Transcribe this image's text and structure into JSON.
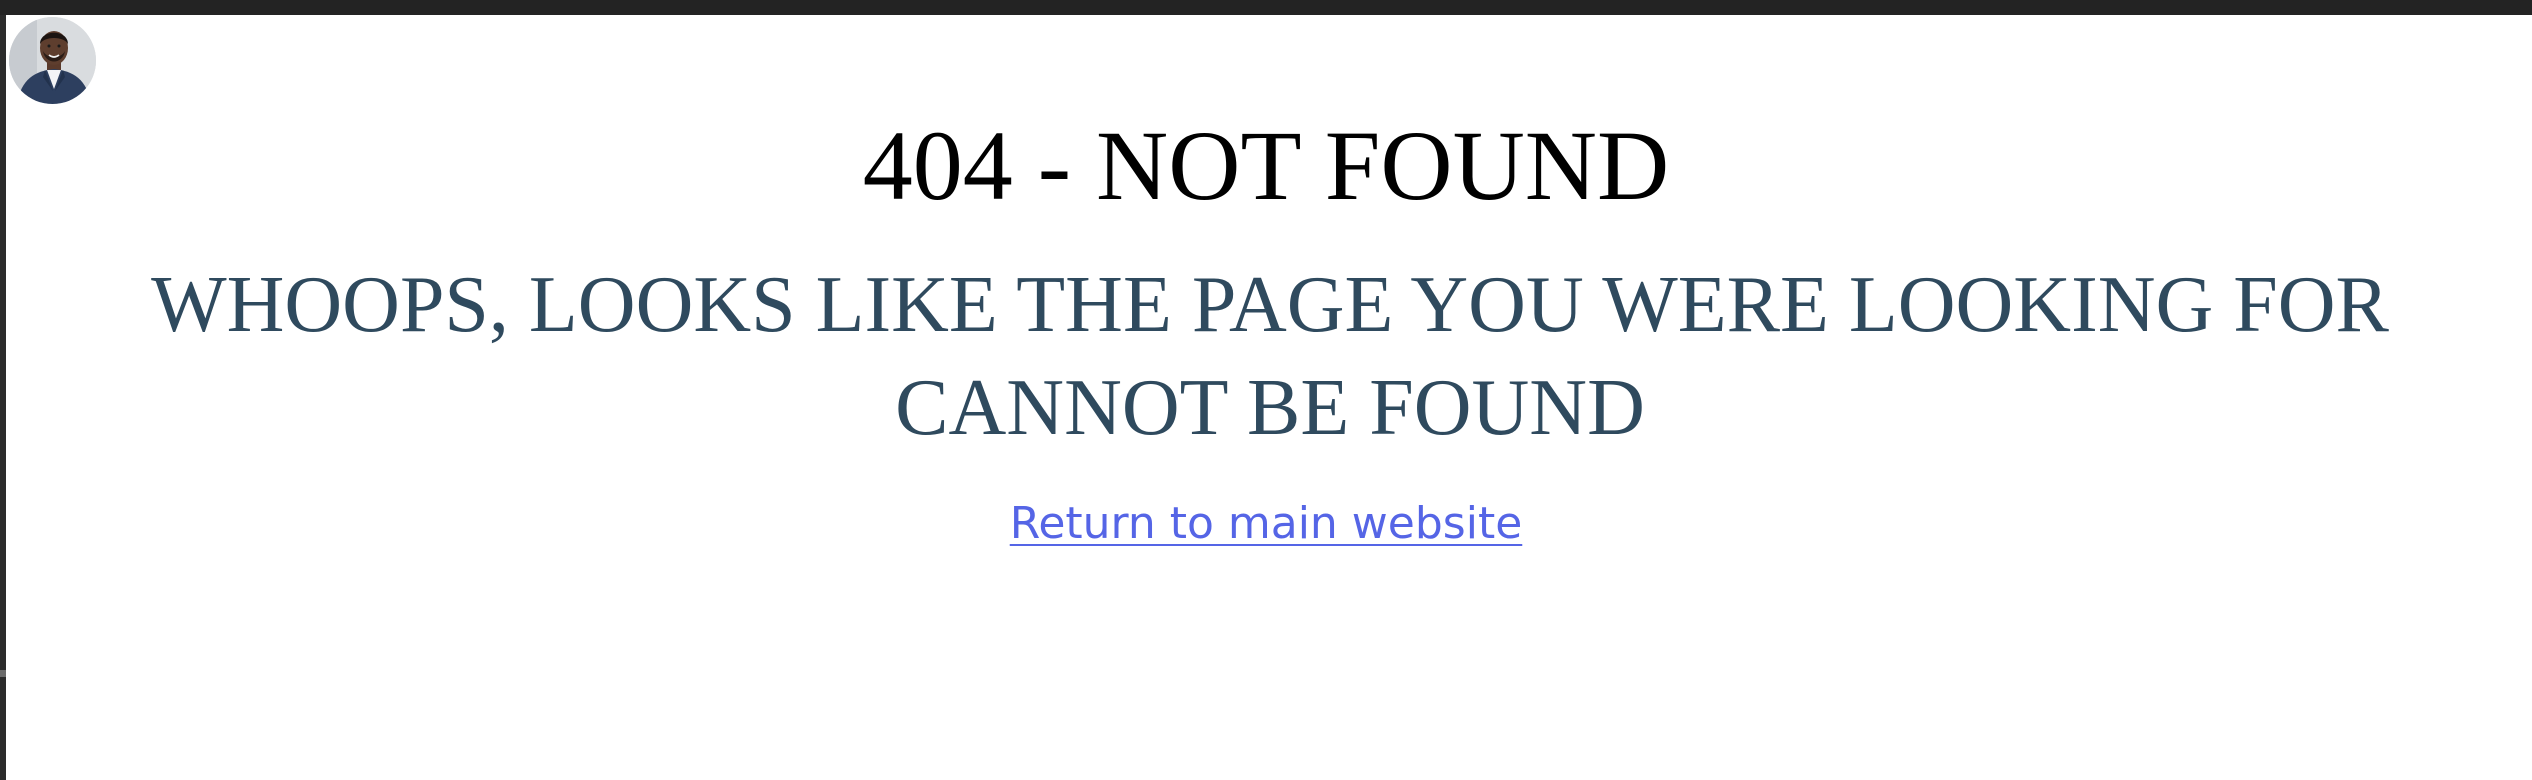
{
  "page": {
    "title": "404 - NOT FOUND",
    "message": "WHOOPS, LOOKS LIKE THE PAGE YOU WERE LOOKING FOR CANNOT BE FOUND",
    "return_link_label": "Return to main website"
  },
  "colors": {
    "top_bar": "#232323",
    "background": "#ffffff",
    "title_text": "#000000",
    "message_text": "#2f4a5e",
    "link": "#5565e6"
  },
  "icons": {
    "avatar": "profile-photo"
  }
}
